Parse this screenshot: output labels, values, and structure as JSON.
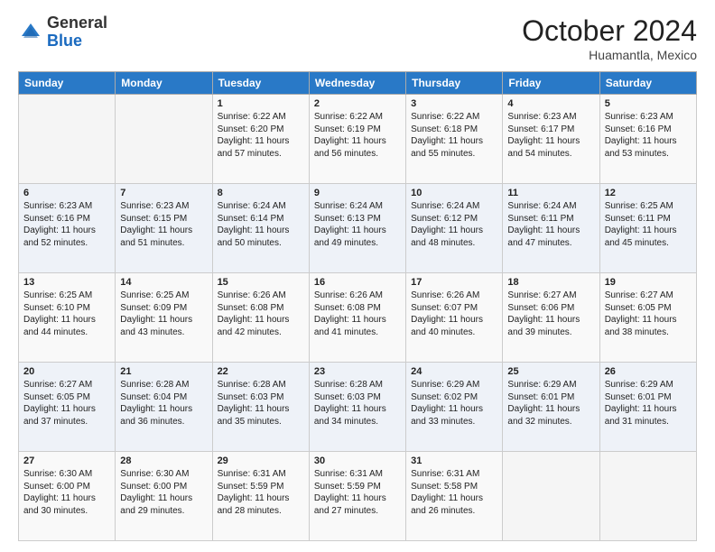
{
  "header": {
    "logo_general": "General",
    "logo_blue": "Blue",
    "month_title": "October 2024",
    "location": "Huamantla, Mexico"
  },
  "weekdays": [
    "Sunday",
    "Monday",
    "Tuesday",
    "Wednesday",
    "Thursday",
    "Friday",
    "Saturday"
  ],
  "weeks": [
    [
      {
        "day": "",
        "sunrise": "",
        "sunset": "",
        "daylight": ""
      },
      {
        "day": "",
        "sunrise": "",
        "sunset": "",
        "daylight": ""
      },
      {
        "day": "1",
        "sunrise": "Sunrise: 6:22 AM",
        "sunset": "Sunset: 6:20 PM",
        "daylight": "Daylight: 11 hours and 57 minutes."
      },
      {
        "day": "2",
        "sunrise": "Sunrise: 6:22 AM",
        "sunset": "Sunset: 6:19 PM",
        "daylight": "Daylight: 11 hours and 56 minutes."
      },
      {
        "day": "3",
        "sunrise": "Sunrise: 6:22 AM",
        "sunset": "Sunset: 6:18 PM",
        "daylight": "Daylight: 11 hours and 55 minutes."
      },
      {
        "day": "4",
        "sunrise": "Sunrise: 6:23 AM",
        "sunset": "Sunset: 6:17 PM",
        "daylight": "Daylight: 11 hours and 54 minutes."
      },
      {
        "day": "5",
        "sunrise": "Sunrise: 6:23 AM",
        "sunset": "Sunset: 6:16 PM",
        "daylight": "Daylight: 11 hours and 53 minutes."
      }
    ],
    [
      {
        "day": "6",
        "sunrise": "Sunrise: 6:23 AM",
        "sunset": "Sunset: 6:16 PM",
        "daylight": "Daylight: 11 hours and 52 minutes."
      },
      {
        "day": "7",
        "sunrise": "Sunrise: 6:23 AM",
        "sunset": "Sunset: 6:15 PM",
        "daylight": "Daylight: 11 hours and 51 minutes."
      },
      {
        "day": "8",
        "sunrise": "Sunrise: 6:24 AM",
        "sunset": "Sunset: 6:14 PM",
        "daylight": "Daylight: 11 hours and 50 minutes."
      },
      {
        "day": "9",
        "sunrise": "Sunrise: 6:24 AM",
        "sunset": "Sunset: 6:13 PM",
        "daylight": "Daylight: 11 hours and 49 minutes."
      },
      {
        "day": "10",
        "sunrise": "Sunrise: 6:24 AM",
        "sunset": "Sunset: 6:12 PM",
        "daylight": "Daylight: 11 hours and 48 minutes."
      },
      {
        "day": "11",
        "sunrise": "Sunrise: 6:24 AM",
        "sunset": "Sunset: 6:11 PM",
        "daylight": "Daylight: 11 hours and 47 minutes."
      },
      {
        "day": "12",
        "sunrise": "Sunrise: 6:25 AM",
        "sunset": "Sunset: 6:11 PM",
        "daylight": "Daylight: 11 hours and 45 minutes."
      }
    ],
    [
      {
        "day": "13",
        "sunrise": "Sunrise: 6:25 AM",
        "sunset": "Sunset: 6:10 PM",
        "daylight": "Daylight: 11 hours and 44 minutes."
      },
      {
        "day": "14",
        "sunrise": "Sunrise: 6:25 AM",
        "sunset": "Sunset: 6:09 PM",
        "daylight": "Daylight: 11 hours and 43 minutes."
      },
      {
        "day": "15",
        "sunrise": "Sunrise: 6:26 AM",
        "sunset": "Sunset: 6:08 PM",
        "daylight": "Daylight: 11 hours and 42 minutes."
      },
      {
        "day": "16",
        "sunrise": "Sunrise: 6:26 AM",
        "sunset": "Sunset: 6:08 PM",
        "daylight": "Daylight: 11 hours and 41 minutes."
      },
      {
        "day": "17",
        "sunrise": "Sunrise: 6:26 AM",
        "sunset": "Sunset: 6:07 PM",
        "daylight": "Daylight: 11 hours and 40 minutes."
      },
      {
        "day": "18",
        "sunrise": "Sunrise: 6:27 AM",
        "sunset": "Sunset: 6:06 PM",
        "daylight": "Daylight: 11 hours and 39 minutes."
      },
      {
        "day": "19",
        "sunrise": "Sunrise: 6:27 AM",
        "sunset": "Sunset: 6:05 PM",
        "daylight": "Daylight: 11 hours and 38 minutes."
      }
    ],
    [
      {
        "day": "20",
        "sunrise": "Sunrise: 6:27 AM",
        "sunset": "Sunset: 6:05 PM",
        "daylight": "Daylight: 11 hours and 37 minutes."
      },
      {
        "day": "21",
        "sunrise": "Sunrise: 6:28 AM",
        "sunset": "Sunset: 6:04 PM",
        "daylight": "Daylight: 11 hours and 36 minutes."
      },
      {
        "day": "22",
        "sunrise": "Sunrise: 6:28 AM",
        "sunset": "Sunset: 6:03 PM",
        "daylight": "Daylight: 11 hours and 35 minutes."
      },
      {
        "day": "23",
        "sunrise": "Sunrise: 6:28 AM",
        "sunset": "Sunset: 6:03 PM",
        "daylight": "Daylight: 11 hours and 34 minutes."
      },
      {
        "day": "24",
        "sunrise": "Sunrise: 6:29 AM",
        "sunset": "Sunset: 6:02 PM",
        "daylight": "Daylight: 11 hours and 33 minutes."
      },
      {
        "day": "25",
        "sunrise": "Sunrise: 6:29 AM",
        "sunset": "Sunset: 6:01 PM",
        "daylight": "Daylight: 11 hours and 32 minutes."
      },
      {
        "day": "26",
        "sunrise": "Sunrise: 6:29 AM",
        "sunset": "Sunset: 6:01 PM",
        "daylight": "Daylight: 11 hours and 31 minutes."
      }
    ],
    [
      {
        "day": "27",
        "sunrise": "Sunrise: 6:30 AM",
        "sunset": "Sunset: 6:00 PM",
        "daylight": "Daylight: 11 hours and 30 minutes."
      },
      {
        "day": "28",
        "sunrise": "Sunrise: 6:30 AM",
        "sunset": "Sunset: 6:00 PM",
        "daylight": "Daylight: 11 hours and 29 minutes."
      },
      {
        "day": "29",
        "sunrise": "Sunrise: 6:31 AM",
        "sunset": "Sunset: 5:59 PM",
        "daylight": "Daylight: 11 hours and 28 minutes."
      },
      {
        "day": "30",
        "sunrise": "Sunrise: 6:31 AM",
        "sunset": "Sunset: 5:59 PM",
        "daylight": "Daylight: 11 hours and 27 minutes."
      },
      {
        "day": "31",
        "sunrise": "Sunrise: 6:31 AM",
        "sunset": "Sunset: 5:58 PM",
        "daylight": "Daylight: 11 hours and 26 minutes."
      },
      {
        "day": "",
        "sunrise": "",
        "sunset": "",
        "daylight": ""
      },
      {
        "day": "",
        "sunrise": "",
        "sunset": "",
        "daylight": ""
      }
    ]
  ]
}
